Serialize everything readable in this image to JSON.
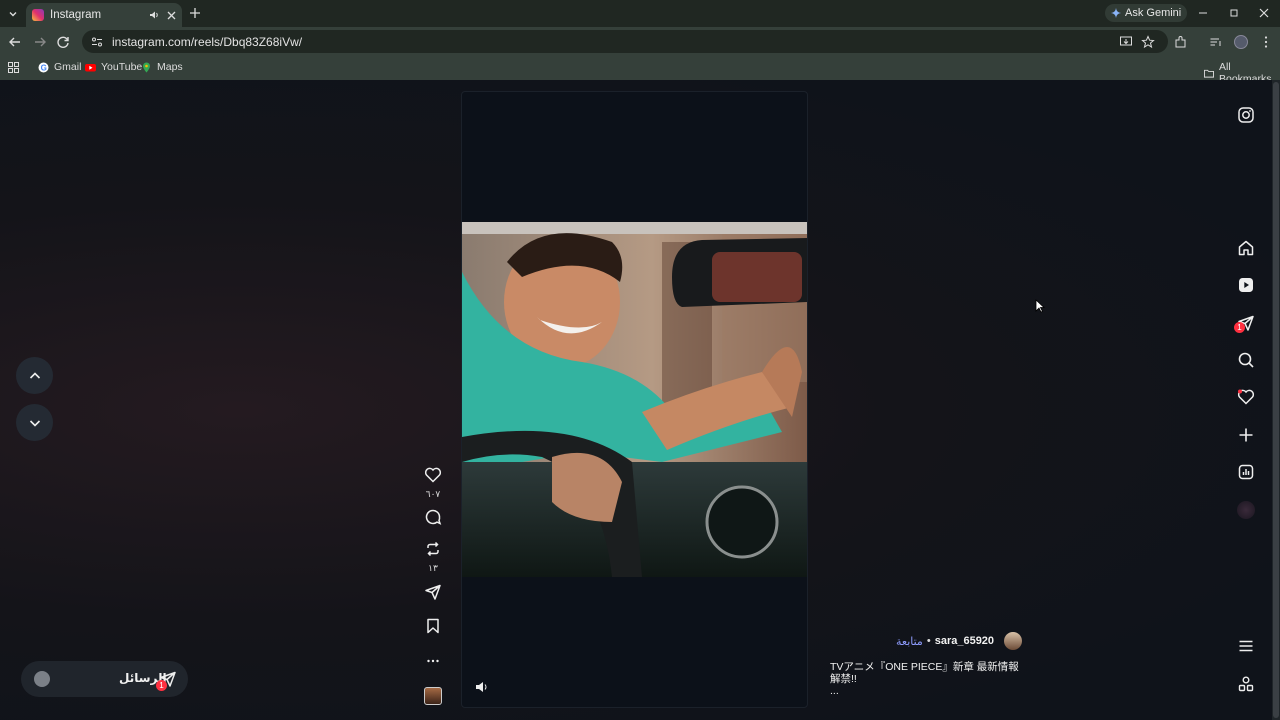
{
  "browser": {
    "tab_title": "Instagram",
    "url": "instagram.com/reels/Dbq83Z68iVw/",
    "ask_gemini": "Ask Gemini",
    "bookmarks": [
      "Gmail",
      "YouTube",
      "Maps"
    ],
    "all_bookmarks": "All Bookmarks"
  },
  "reel": {
    "likes": "٦٠٧",
    "reposts": "١٣",
    "owner": "sara_65920",
    "follow_label": "متابعة",
    "separator": "•",
    "caption_line1": "TVアニメ『ONE PIECE』新章 最新情報",
    "caption_line2": "解禁!!",
    "caption_more": "..."
  },
  "messages": {
    "label": "الرسائل",
    "badge": "1"
  },
  "sidebar": {
    "messages_badge": "1"
  },
  "colors": {
    "page_bg": "#0f131a",
    "accent_badge": "#ff3040",
    "follow_link": "#8f9dff",
    "browser_frame": "#202722",
    "browser_toolbar": "#35403a"
  }
}
